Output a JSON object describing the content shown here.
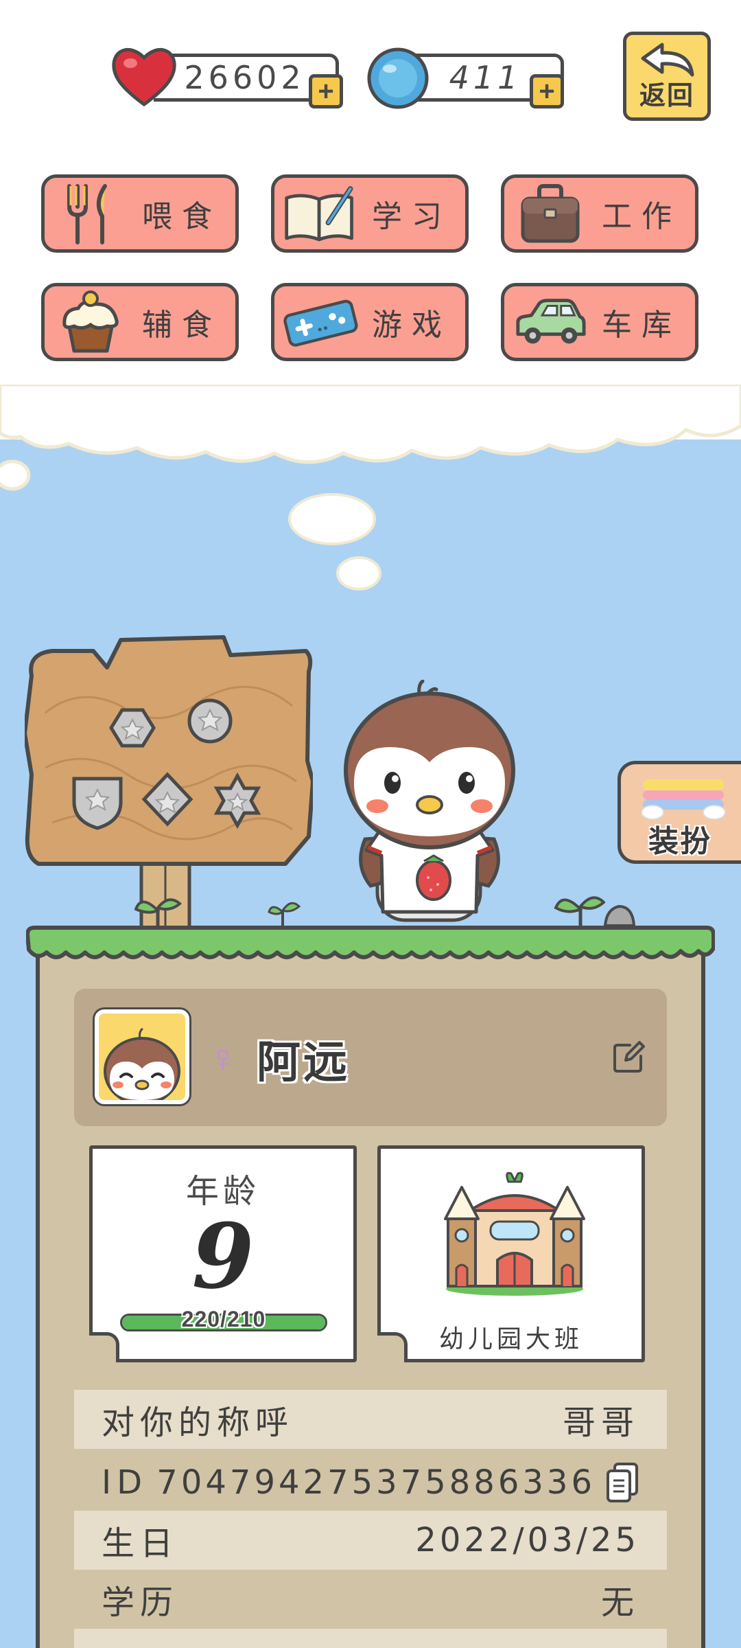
{
  "top_bar": {
    "hearts": "26602",
    "coins": "411",
    "back_label": "返回"
  },
  "actions": [
    {
      "label": "喂食",
      "icon": "fork-knife-icon"
    },
    {
      "label": "学习",
      "icon": "book-icon"
    },
    {
      "label": "工作",
      "icon": "briefcase-icon"
    },
    {
      "label": "辅食",
      "icon": "cupcake-icon"
    },
    {
      "label": "游戏",
      "icon": "gamepad-icon"
    },
    {
      "label": "车库",
      "icon": "car-icon"
    }
  ],
  "dress_button": "装扮",
  "profile": {
    "gender_symbol": "♀",
    "nickname": "阿远"
  },
  "age_card": {
    "title": "年龄",
    "value": "9",
    "progress_text": "220/210",
    "progress_fraction": 1.0
  },
  "school_card": {
    "label": "幼儿园大班"
  },
  "info": {
    "nickname_label": "对你的称呼",
    "nickname_value": "哥哥",
    "id_label": "ID",
    "id_value": "704794275375886336",
    "birthday_label": "生日",
    "birthday_value": "2022/03/25",
    "education_label": "学历",
    "education_value": "无"
  },
  "colors": {
    "sky": "#abd2f3",
    "button": "#fb9f92",
    "gold": "#fbd86b",
    "panel": "#d1c3a6",
    "grass": "#7cc76a"
  }
}
